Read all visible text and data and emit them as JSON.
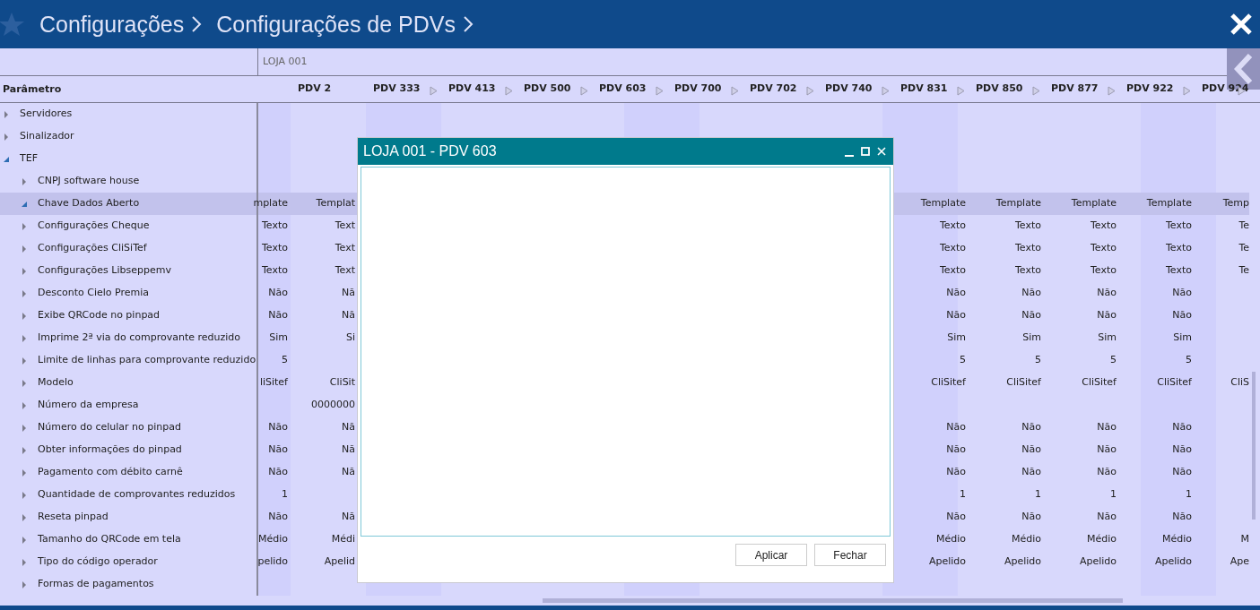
{
  "header": {
    "breadcrumbs": [
      "Configurações",
      "Configurações de PDVs"
    ]
  },
  "store": {
    "label": "LOJA 001"
  },
  "grid": {
    "parameter_heading": "Parâmetro",
    "columns": [
      {
        "label": "PDV 2",
        "expandable": false
      },
      {
        "label": "PDV 333",
        "expandable": true
      },
      {
        "label": "PDV 413",
        "expandable": true
      },
      {
        "label": "PDV 500",
        "expandable": true
      },
      {
        "label": "PDV 603",
        "expandable": true
      },
      {
        "label": "PDV 700",
        "expandable": true
      },
      {
        "label": "PDV 702",
        "expandable": true
      },
      {
        "label": "PDV 740",
        "expandable": true
      },
      {
        "label": "PDV 831",
        "expandable": true
      },
      {
        "label": "PDV 850",
        "expandable": true
      },
      {
        "label": "PDV 877",
        "expandable": true
      },
      {
        "label": "PDV 922",
        "expandable": true
      },
      {
        "label": "PDV 924",
        "expandable": true
      }
    ],
    "rows": [
      {
        "label": "Servidores",
        "expanded": false,
        "selected": false
      },
      {
        "label": "Sinalizador",
        "expanded": false,
        "selected": false
      },
      {
        "label": "TEF",
        "expanded": true,
        "selected": false,
        "children": [
          {
            "label": "CNPJ software house",
            "expanded": false,
            "selected": false
          },
          {
            "label": "Chave Dados Aberto",
            "expanded": true,
            "selected": true,
            "cells": [
              "mplate",
              "Templat",
              null,
              null,
              null,
              null,
              null,
              null,
              null,
              "Template",
              "Template",
              "Template",
              "Template",
              "Temp"
            ]
          },
          {
            "label": "Configurações Cheque",
            "expanded": false,
            "selected": false,
            "cells": [
              "Texto",
              "Text",
              null,
              null,
              null,
              null,
              null,
              null,
              null,
              "Texto",
              "Texto",
              "Texto",
              "Texto",
              "Te"
            ]
          },
          {
            "label": "Configurações CliSiTef",
            "expanded": false,
            "selected": false,
            "cells": [
              "Texto",
              "Text",
              null,
              null,
              null,
              null,
              null,
              null,
              null,
              "Texto",
              "Texto",
              "Texto",
              "Texto",
              "Te"
            ]
          },
          {
            "label": "Configurações Libseppemv",
            "expanded": false,
            "selected": false,
            "cells": [
              "Texto",
              "Text",
              null,
              null,
              null,
              null,
              null,
              null,
              null,
              "Texto",
              "Texto",
              "Texto",
              "Texto",
              "Te"
            ]
          },
          {
            "label": "Desconto Cielo Premia",
            "expanded": false,
            "selected": false,
            "cells": [
              "Não",
              "Nã",
              null,
              null,
              null,
              null,
              null,
              null,
              null,
              "Não",
              "Não",
              "Não",
              "Não",
              null
            ]
          },
          {
            "label": "Exibe QRCode no pinpad",
            "expanded": false,
            "selected": false,
            "cells": [
              "Não",
              "Nã",
              null,
              null,
              null,
              null,
              null,
              null,
              null,
              "Não",
              "Não",
              "Não",
              "Não",
              null
            ]
          },
          {
            "label": "Imprime 2ª via do comprovante reduzido",
            "expanded": false,
            "selected": false,
            "cells": [
              "Sim",
              "Si",
              null,
              null,
              null,
              null,
              null,
              null,
              null,
              "Sim",
              "Sim",
              "Sim",
              "Sim",
              null
            ]
          },
          {
            "label": "Limite de linhas para comprovante reduzido",
            "expanded": false,
            "selected": false,
            "cells": [
              "5",
              null,
              null,
              null,
              null,
              null,
              null,
              null,
              null,
              "5",
              "5",
              "5",
              "5",
              null
            ]
          },
          {
            "label": "Modelo",
            "expanded": false,
            "selected": false,
            "cells": [
              "liSitef",
              "CliSit",
              null,
              null,
              null,
              null,
              null,
              null,
              null,
              "CliSitef",
              "CliSitef",
              "CliSitef",
              "CliSitef",
              "CliS"
            ]
          },
          {
            "label": "Número da empresa",
            "expanded": false,
            "selected": false,
            "cells": [
              null,
              "0000000",
              null,
              null,
              null,
              null,
              null,
              null,
              null,
              null,
              null,
              null,
              null,
              null
            ]
          },
          {
            "label": "Número do celular no pinpad",
            "expanded": false,
            "selected": false,
            "cells": [
              "Não",
              "Nã",
              null,
              null,
              null,
              null,
              null,
              null,
              null,
              "Não",
              "Não",
              "Não",
              "Não",
              null
            ]
          },
          {
            "label": "Obter informações do pinpad",
            "expanded": false,
            "selected": false,
            "cells": [
              "Não",
              "Nã",
              null,
              null,
              null,
              null,
              null,
              null,
              null,
              "Não",
              "Não",
              "Não",
              "Não",
              null
            ]
          },
          {
            "label": "Pagamento com débito carnê",
            "expanded": false,
            "selected": false,
            "cells": [
              "Não",
              "Nã",
              null,
              null,
              null,
              null,
              null,
              null,
              null,
              "Não",
              "Não",
              "Não",
              "Não",
              null
            ]
          },
          {
            "label": "Quantidade de comprovantes reduzidos",
            "expanded": false,
            "selected": false,
            "cells": [
              "1",
              null,
              null,
              null,
              null,
              null,
              null,
              null,
              null,
              "1",
              "1",
              "1",
              "1",
              null
            ]
          },
          {
            "label": "Reseta pinpad",
            "expanded": false,
            "selected": false,
            "cells": [
              "Não",
              "Nã",
              null,
              null,
              null,
              null,
              null,
              null,
              null,
              "Não",
              "Não",
              "Não",
              "Não",
              null
            ]
          },
          {
            "label": "Tamanho do QRCode em tela",
            "expanded": false,
            "selected": false,
            "cells": [
              "Médio",
              "Médi",
              null,
              null,
              null,
              null,
              null,
              null,
              null,
              "Médio",
              "Médio",
              "Médio",
              "Médio",
              "M"
            ]
          },
          {
            "label": "Tipo do código operador",
            "expanded": false,
            "selected": false,
            "cells": [
              "pelido",
              "Apelid",
              null,
              null,
              null,
              null,
              null,
              null,
              null,
              "Apelido",
              "Apelido",
              "Apelido",
              "Apelido",
              "Ape"
            ]
          },
          {
            "label": "Formas de pagamentos",
            "expanded": false,
            "selected": false
          }
        ]
      }
    ]
  },
  "dialog": {
    "title": "LOJA 001 - PDV 603",
    "buttons": [
      "Aplicar",
      "Fechar"
    ]
  }
}
